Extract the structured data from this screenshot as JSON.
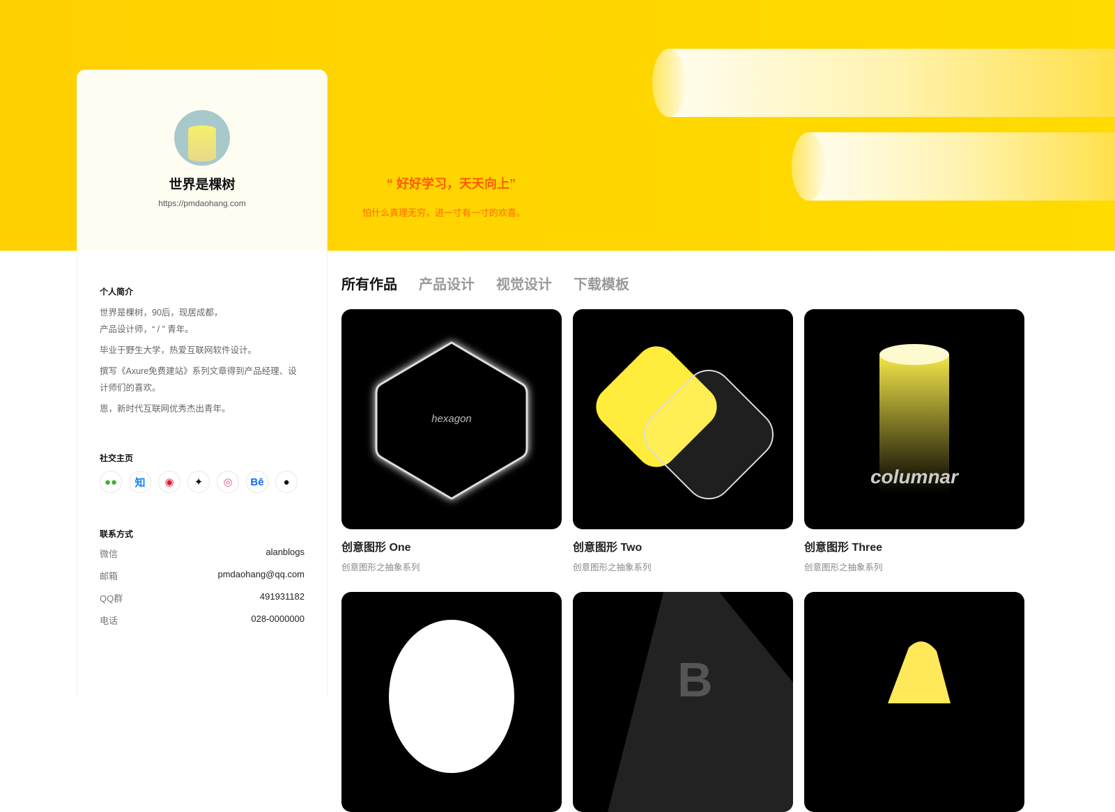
{
  "profile": {
    "name": "世界是棵树",
    "url": "https://pmdaohang.com"
  },
  "banner": {
    "quote": "“ 好好学习，天天向上”",
    "subtitle": "怕什么真理无穷，进一寸有一寸的欢喜。"
  },
  "about": {
    "heading": "个人简介",
    "paragraphs": [
      "世界是棵树，90后，现居成都，\n产品设计师，“ / ” 青年。",
      "毕业于野生大学，热爱互联网软件设计。",
      "撰写《Axure免费建站》系列文章得到产品经理、设计师们的喜欢。",
      "恩，新时代互联网优秀杰出青年。"
    ]
  },
  "social": {
    "heading": "社交主页",
    "items": [
      {
        "icon": "wechat-icon",
        "glyph": "●●",
        "color": "#3cb034"
      },
      {
        "icon": "zhihu-icon",
        "glyph": "知",
        "color": "#0a84ff"
      },
      {
        "icon": "weibo-icon",
        "glyph": "◉",
        "color": "#e6162d"
      },
      {
        "icon": "jike-icon",
        "glyph": "✦",
        "color": "#111111"
      },
      {
        "icon": "dribbble-icon",
        "glyph": "◎",
        "color": "#ea4c89"
      },
      {
        "icon": "behance-icon",
        "glyph": "Bē",
        "color": "#1769ff"
      },
      {
        "icon": "github-icon",
        "glyph": "●",
        "color": "#111111"
      }
    ]
  },
  "contact": {
    "heading": "联系方式",
    "rows": [
      {
        "label": "微信",
        "value": "alanblogs"
      },
      {
        "label": "邮箱",
        "value": "pmdaohang@qq.com"
      },
      {
        "label": "QQ群",
        "value": "491931182"
      },
      {
        "label": "电话",
        "value": "028-0000000"
      }
    ]
  },
  "tabs": [
    "所有作品",
    "产品设计",
    "视觉设计",
    "下载模板"
  ],
  "works": [
    {
      "title": "创意图形 One",
      "subtitle": "创意图形之抽象系列",
      "art_text": "hexagon"
    },
    {
      "title": "创意图形 Two",
      "subtitle": "创意图形之抽象系列"
    },
    {
      "title": "创意图形 Three",
      "subtitle": "创意图形之抽象系列",
      "art_text": "columnar"
    }
  ],
  "colors": {
    "banner": "#ffd500",
    "accent": "#ff5a00"
  }
}
